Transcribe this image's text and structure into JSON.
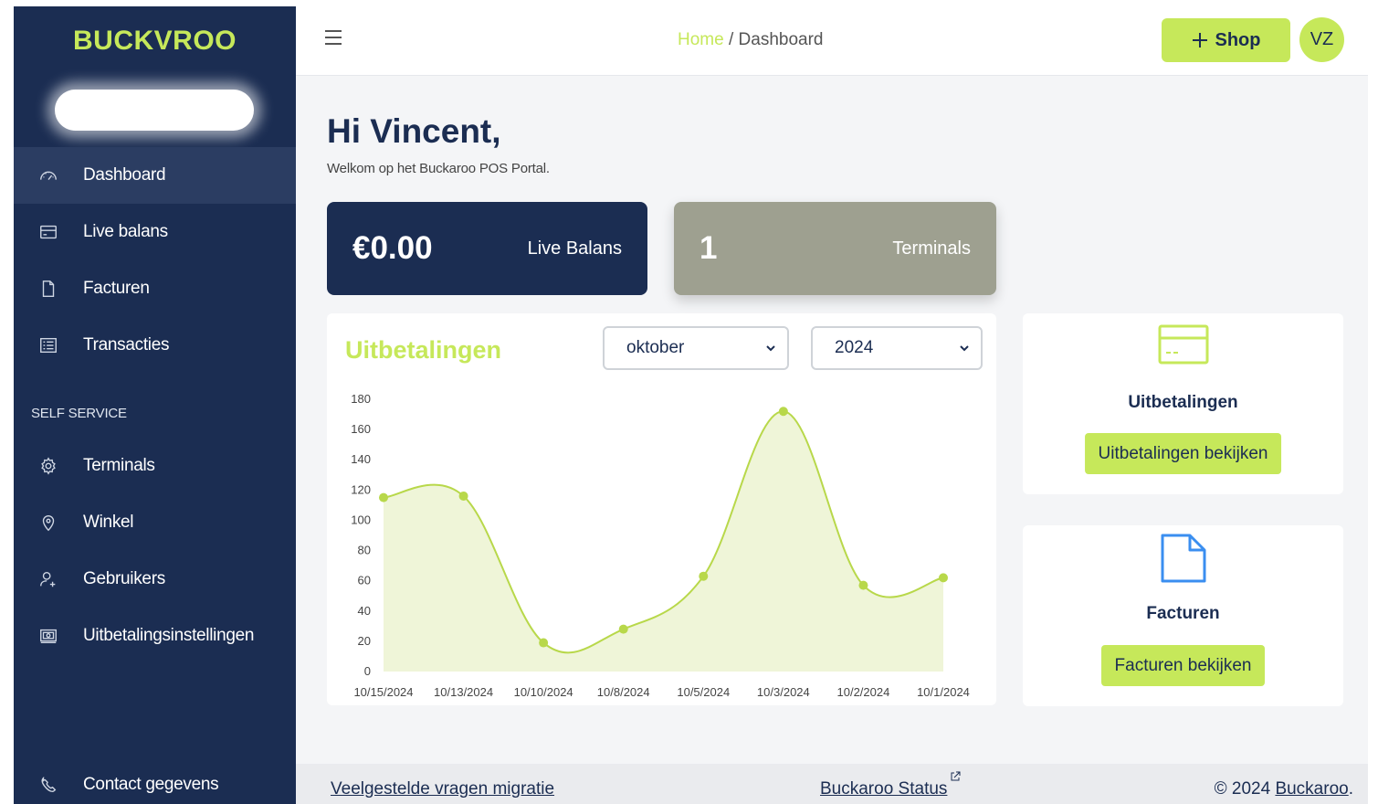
{
  "brand": {
    "logo_text": "BUCKVROO",
    "accent": "#c6e85a",
    "navy": "#1b2d52"
  },
  "sidebar": {
    "items": [
      {
        "label": "Dashboard",
        "icon": "gauge-icon"
      },
      {
        "label": "Live balans",
        "icon": "credit-card-icon"
      },
      {
        "label": "Facturen",
        "icon": "document-icon"
      },
      {
        "label": "Transacties",
        "icon": "list-icon"
      }
    ],
    "section_label": "SELF SERVICE",
    "self_service": [
      {
        "label": "Terminals",
        "icon": "gear-icon"
      },
      {
        "label": "Winkel",
        "icon": "location-pin-icon"
      },
      {
        "label": "Gebruikers",
        "icon": "add-user-icon"
      },
      {
        "label": "Uitbetalingsinstellingen",
        "icon": "payout-settings-icon"
      }
    ],
    "contact": {
      "label": "Contact gegevens",
      "icon": "phone-icon"
    }
  },
  "topbar": {
    "breadcrumb_home": "Home",
    "breadcrumb_sep": "/",
    "breadcrumb_current": "Dashboard",
    "shop_label": "Shop",
    "avatar_initials": "VZ"
  },
  "main": {
    "greeting": "Hi Vincent,",
    "welcome": "Welkom op het Buckaroo POS Portal."
  },
  "stats": {
    "balance_value": "€0.00",
    "balance_label": "Live Balans",
    "terminals_value": "1",
    "terminals_label": "Terminals"
  },
  "chart_panel": {
    "title": "Uitbetalingen",
    "month_selected": "oktober",
    "year_selected": "2024"
  },
  "chart_data": {
    "type": "area",
    "x": [
      "10/15/2024",
      "10/13/2024",
      "10/10/2024",
      "10/8/2024",
      "10/5/2024",
      "10/3/2024",
      "10/2/2024",
      "10/1/2024"
    ],
    "series": [
      {
        "values": [
          115,
          116,
          19,
          28,
          63,
          172,
          57,
          62
        ]
      }
    ],
    "yticks": [
      0,
      20,
      40,
      60,
      80,
      100,
      120,
      140,
      160,
      180
    ],
    "ylim": [
      0,
      180
    ],
    "line_color": "#b8d84a",
    "fill_color": "#eff5d8"
  },
  "cards": {
    "payouts_title": "Uitbetalingen",
    "payouts_button": "Uitbetalingen bekijken",
    "invoices_title": "Facturen",
    "invoices_button": "Facturen bekijken"
  },
  "footer": {
    "faq_link": "Veelgestelde vragen migratie",
    "status_link": "Buckaroo Status",
    "copyright": "© 2024",
    "copyright_link": "Buckaroo",
    "copyright_end": "."
  }
}
